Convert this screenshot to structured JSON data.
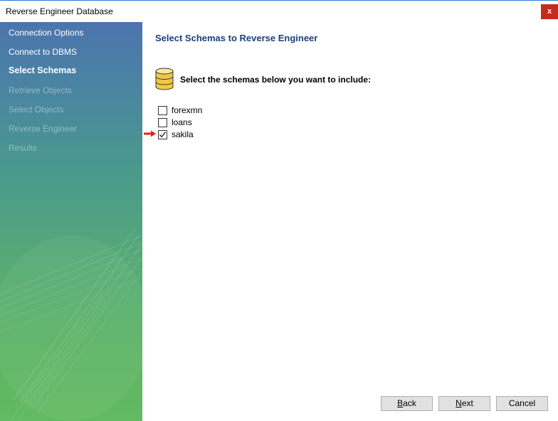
{
  "window": {
    "title": "Reverse Engineer Database",
    "close_label": "x"
  },
  "sidebar": {
    "items": [
      {
        "label": "Connection Options",
        "state": "done"
      },
      {
        "label": "Connect to DBMS",
        "state": "done"
      },
      {
        "label": "Select Schemas",
        "state": "current"
      },
      {
        "label": "Retrieve Objects",
        "state": "pending"
      },
      {
        "label": "Select Objects",
        "state": "pending"
      },
      {
        "label": "Reverse Engineer",
        "state": "pending"
      },
      {
        "label": "Results",
        "state": "pending"
      }
    ]
  },
  "main": {
    "heading": "Select Schemas to Reverse Engineer",
    "instruction": "Select the schemas below you want to include:",
    "schemas": [
      {
        "name": "forexmn",
        "checked": false
      },
      {
        "name": "loans",
        "checked": false
      },
      {
        "name": "sakila",
        "checked": true
      }
    ]
  },
  "buttons": {
    "back": {
      "first": "B",
      "rest": "ack"
    },
    "next": {
      "first": "N",
      "rest": "ext"
    },
    "cancel": {
      "label": "Cancel"
    }
  },
  "colors": {
    "heading": "#1c3f7e",
    "close_button": "#c42b1c",
    "marker_arrow": "#e8201a",
    "sidebar_top": "#4c74ad",
    "sidebar_bottom": "#62ba62"
  },
  "icons": {
    "database": "database-icon",
    "checkmark": "checkmark-icon",
    "marker": "red-arrow-icon"
  }
}
